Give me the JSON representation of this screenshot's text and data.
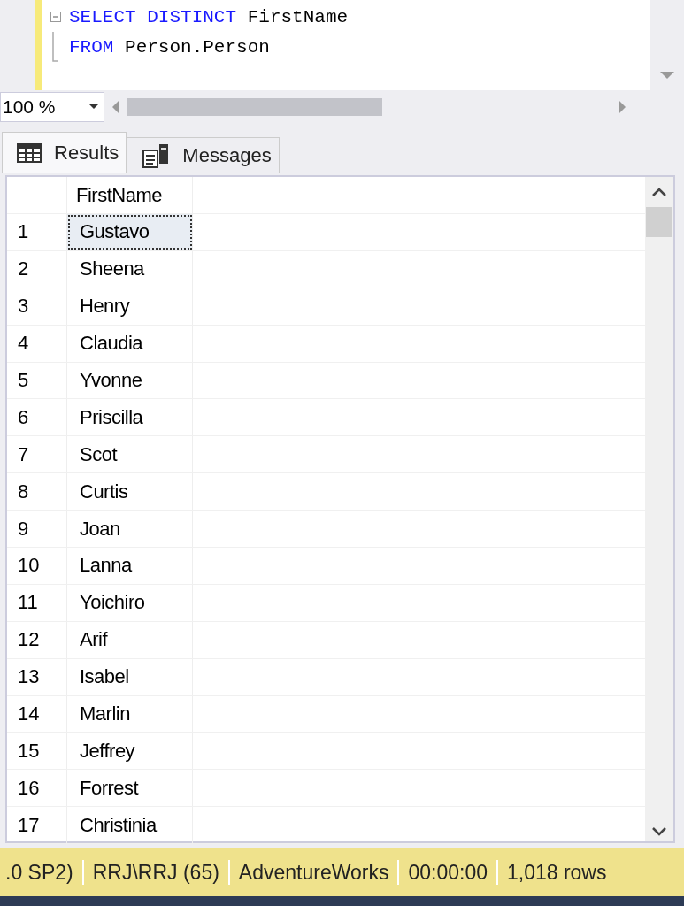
{
  "editor": {
    "lines": [
      {
        "collapsible": true,
        "tokens": [
          {
            "kind": "keyword",
            "text": "SELECT"
          },
          {
            "kind": "keyword",
            "text": "DISTINCT"
          },
          {
            "kind": "ident",
            "text": "FirstName"
          }
        ]
      },
      {
        "collapsible": false,
        "tokens": [
          {
            "kind": "keyword",
            "text": "FROM"
          },
          {
            "kind": "ident",
            "text": "Person.Person"
          }
        ]
      }
    ]
  },
  "zoom": {
    "value": "100 %"
  },
  "tabs": [
    {
      "label": "Results",
      "selected": true
    },
    {
      "label": "Messages",
      "selected": false
    }
  ],
  "grid": {
    "columns": [
      "FirstName"
    ],
    "rows": [
      {
        "num": "1",
        "cells": [
          "Gustavo"
        ],
        "selected": true
      },
      {
        "num": "2",
        "cells": [
          "Sheena"
        ],
        "selected": false
      },
      {
        "num": "3",
        "cells": [
          "Henry"
        ],
        "selected": false
      },
      {
        "num": "4",
        "cells": [
          "Claudia"
        ],
        "selected": false
      },
      {
        "num": "5",
        "cells": [
          "Yvonne"
        ],
        "selected": false
      },
      {
        "num": "6",
        "cells": [
          "Priscilla"
        ],
        "selected": false
      },
      {
        "num": "7",
        "cells": [
          "Scot"
        ],
        "selected": false
      },
      {
        "num": "8",
        "cells": [
          "Curtis"
        ],
        "selected": false
      },
      {
        "num": "9",
        "cells": [
          "Joan"
        ],
        "selected": false
      },
      {
        "num": "10",
        "cells": [
          "Lanna"
        ],
        "selected": false
      },
      {
        "num": "11",
        "cells": [
          "Yoichiro"
        ],
        "selected": false
      },
      {
        "num": "12",
        "cells": [
          "Arif"
        ],
        "selected": false
      },
      {
        "num": "13",
        "cells": [
          "Isabel"
        ],
        "selected": false
      },
      {
        "num": "14",
        "cells": [
          "Marlin"
        ],
        "selected": false
      },
      {
        "num": "15",
        "cells": [
          "Jeffrey"
        ],
        "selected": false
      },
      {
        "num": "16",
        "cells": [
          "Forrest"
        ],
        "selected": false
      },
      {
        "num": "17",
        "cells": [
          "Christinia"
        ],
        "selected": false
      }
    ]
  },
  "status_bar": [
    ".0 SP2)",
    "RRJ\\RRJ (65)",
    "AdventureWorks",
    "00:00:00",
    "1,018 rows"
  ]
}
